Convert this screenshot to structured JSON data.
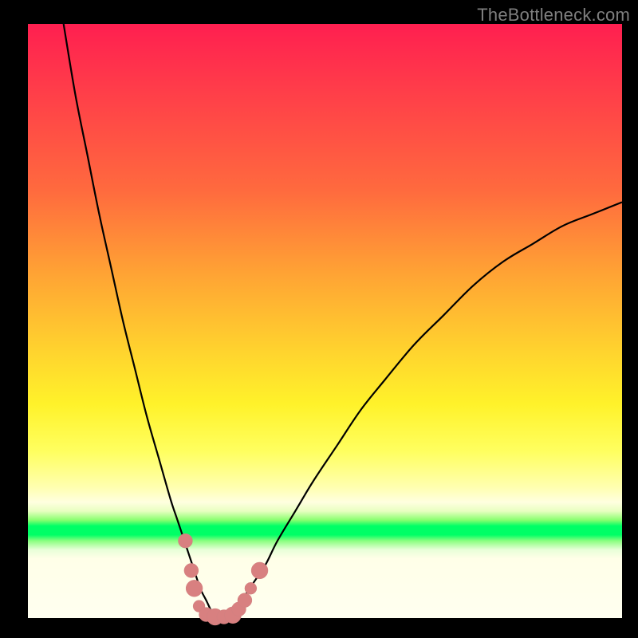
{
  "watermark": "TheBottleneck.com",
  "chart_data": {
    "type": "line",
    "title": "",
    "xlabel": "",
    "ylabel": "",
    "xlim": [
      0,
      100
    ],
    "ylim": [
      0,
      100
    ],
    "gradient_bands": [
      {
        "name": "red",
        "approx_y_pct": 0
      },
      {
        "name": "orange",
        "approx_y_pct": 35
      },
      {
        "name": "yellow",
        "approx_y_pct": 60
      },
      {
        "name": "pale",
        "approx_y_pct": 80
      },
      {
        "name": "green",
        "approx_y_pct": 85
      },
      {
        "name": "white",
        "approx_y_pct": 95
      }
    ],
    "series": [
      {
        "name": "left-curve",
        "x": [
          6,
          8,
          10,
          12,
          14,
          16,
          18,
          20,
          22,
          24,
          25,
          26,
          27,
          28,
          29,
          30,
          31,
          32
        ],
        "values": [
          100,
          88,
          78,
          68,
          59,
          50,
          42,
          34,
          27,
          20,
          17,
          14,
          11,
          8,
          5,
          3,
          1,
          0
        ]
      },
      {
        "name": "right-curve",
        "x": [
          34,
          36,
          38,
          40,
          42,
          45,
          48,
          52,
          56,
          60,
          65,
          70,
          75,
          80,
          85,
          90,
          95,
          100
        ],
        "values": [
          0,
          3,
          6,
          9,
          13,
          18,
          23,
          29,
          35,
          40,
          46,
          51,
          56,
          60,
          63,
          66,
          68,
          70
        ]
      }
    ],
    "data_points": [
      {
        "x": 26.5,
        "value": 13,
        "r": 1.2
      },
      {
        "x": 27.5,
        "value": 8,
        "r": 1.2
      },
      {
        "x": 28.0,
        "value": 5,
        "r": 1.4
      },
      {
        "x": 28.8,
        "value": 2,
        "r": 1.0
      },
      {
        "x": 30.0,
        "value": 0.6,
        "r": 1.2
      },
      {
        "x": 31.5,
        "value": 0.2,
        "r": 1.4
      },
      {
        "x": 33.0,
        "value": 0.2,
        "r": 1.2
      },
      {
        "x": 34.5,
        "value": 0.5,
        "r": 1.4
      },
      {
        "x": 35.5,
        "value": 1.5,
        "r": 1.2
      },
      {
        "x": 36.5,
        "value": 3.0,
        "r": 1.2
      },
      {
        "x": 37.5,
        "value": 5.0,
        "r": 1.0
      },
      {
        "x": 39.0,
        "value": 8.0,
        "r": 1.4
      }
    ]
  }
}
